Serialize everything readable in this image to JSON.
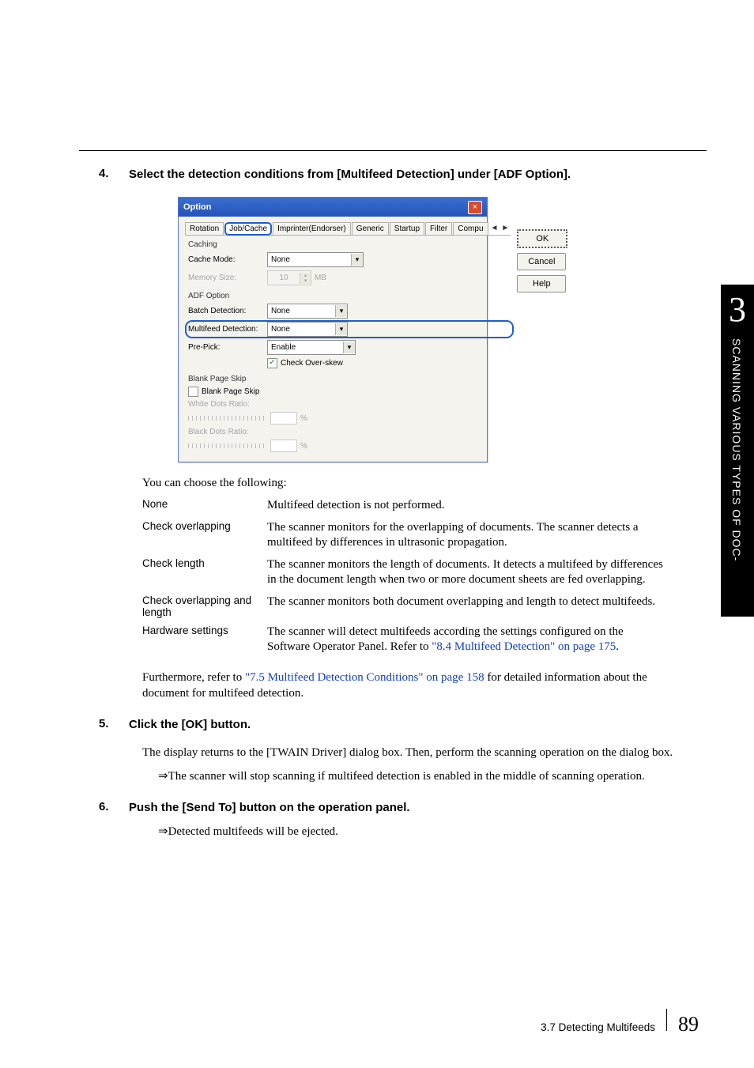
{
  "sidebar": {
    "chapter_number": "3",
    "vertical_label": "SCANNING VARIOUS TYPES OF DOC-"
  },
  "steps": {
    "s4": {
      "num": "4.",
      "text": "Select the detection conditions from [Multifeed Detection] under [ADF Option]."
    },
    "s5": {
      "num": "5.",
      "text": "Click the [OK] button."
    },
    "s6": {
      "num": "6.",
      "text": "Push the [Send To] button on the operation panel."
    }
  },
  "dialog": {
    "title": "Option",
    "close": "×",
    "tabs": {
      "rotation": "Rotation",
      "jobcache": "Job/Cache",
      "imprinter": "Imprinter(Endorser)",
      "generic": "Generic",
      "startup": "Startup",
      "filter": "Filter",
      "compu": "Compu",
      "arrow_l": "◄",
      "arrow_r": "►"
    },
    "caching": {
      "title": "Caching",
      "cache_mode_label": "Cache Mode:",
      "cache_mode_value": "None",
      "memory_label": "Memory Size:",
      "memory_value": "10",
      "memory_unit": "MB"
    },
    "adf": {
      "title": "ADF Option",
      "batch_label": "Batch Detection:",
      "batch_value": "None",
      "mf_label": "Multifeed Detection:",
      "mf_value": "None",
      "prepick_label": "Pre-Pick:",
      "prepick_value": "Enable",
      "overskew_label": "Check Over-skew"
    },
    "blank": {
      "title": "Blank Page Skip",
      "checkbox": "Blank Page Skip",
      "white_label": "White Dots Ratio:",
      "black_label": "Black Dots Ratio:",
      "pct": "%"
    },
    "buttons": {
      "ok": "OK",
      "cancel": "Cancel",
      "help": "Help"
    }
  },
  "lead_in": "You can choose the following:",
  "choices": {
    "none": {
      "k": "None",
      "d": "Multifeed detection is not performed."
    },
    "ov": {
      "k": "Check overlapping",
      "d": "The scanner monitors for the overlapping of documents. The scanner detects a multifeed by differences in ultrasonic propagation."
    },
    "len": {
      "k": "Check length",
      "d": "The scanner monitors the length of documents. It detects a multifeed by differences in the document length when two or more document sheets are fed overlapping."
    },
    "both": {
      "k": "Check overlapping and length",
      "d": "The scanner monitors both document overlapping and length to detect multifeeds."
    },
    "hw": {
      "k": "Hardware settings",
      "d_pre": "The scanner will detect multifeeds according the settings configured on the Software Operator Panel. Refer to ",
      "d_link": "\"8.4 Multifeed Detection\" on page 175",
      "d_post": "."
    }
  },
  "further": {
    "pre": "Furthermore, refer to ",
    "link": "\"7.5 Multifeed Detection Conditions\" on page 158",
    "post": " for detailed information about the document for multifeed detection."
  },
  "s5_body": "The display returns to the [TWAIN Driver] dialog box. Then, perform the scanning operation on the dialog box.",
  "s5_arrow": "⇒The scanner will stop scanning if multifeed detection is enabled in the middle of scanning operation.",
  "s6_arrow": "⇒Detected multifeeds will be ejected.",
  "footer": {
    "section": "3.7 Detecting Multifeeds",
    "page": "89"
  }
}
